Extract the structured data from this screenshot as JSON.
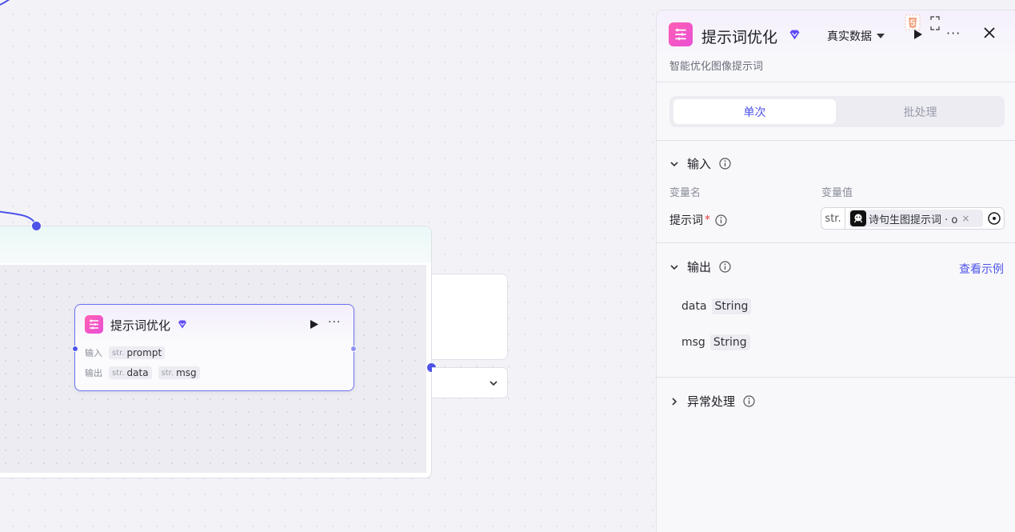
{
  "node": {
    "title": "提示词优化",
    "input_label": "输入",
    "output_label": "输出",
    "type_prefix": "str.",
    "input_param": "prompt",
    "output_params": [
      "data",
      "msg"
    ]
  },
  "panel": {
    "title": "提示词优化",
    "data_mode": "真实数据",
    "description": "智能优化图像提示词",
    "tabs": {
      "single": "单次",
      "batch": "批处理"
    },
    "input_section": {
      "title": "输入",
      "col_name": "变量名",
      "col_value": "变量值",
      "field_label": "提示词",
      "required_mark": "*",
      "value_type": "str.",
      "value_ref": "诗句生图提示词 · o"
    },
    "output_section": {
      "title": "输出",
      "view_example": "查看示例",
      "fields": [
        {
          "name": "data",
          "type": "String"
        },
        {
          "name": "msg",
          "type": "String"
        }
      ]
    },
    "error_section": {
      "title": "异常处理"
    }
  },
  "colors": {
    "accent": "#4d53e8",
    "icon_gradient_start": "#ff5fb2",
    "icon_gradient_end": "#e94fd6",
    "required": "#e53a3a"
  }
}
